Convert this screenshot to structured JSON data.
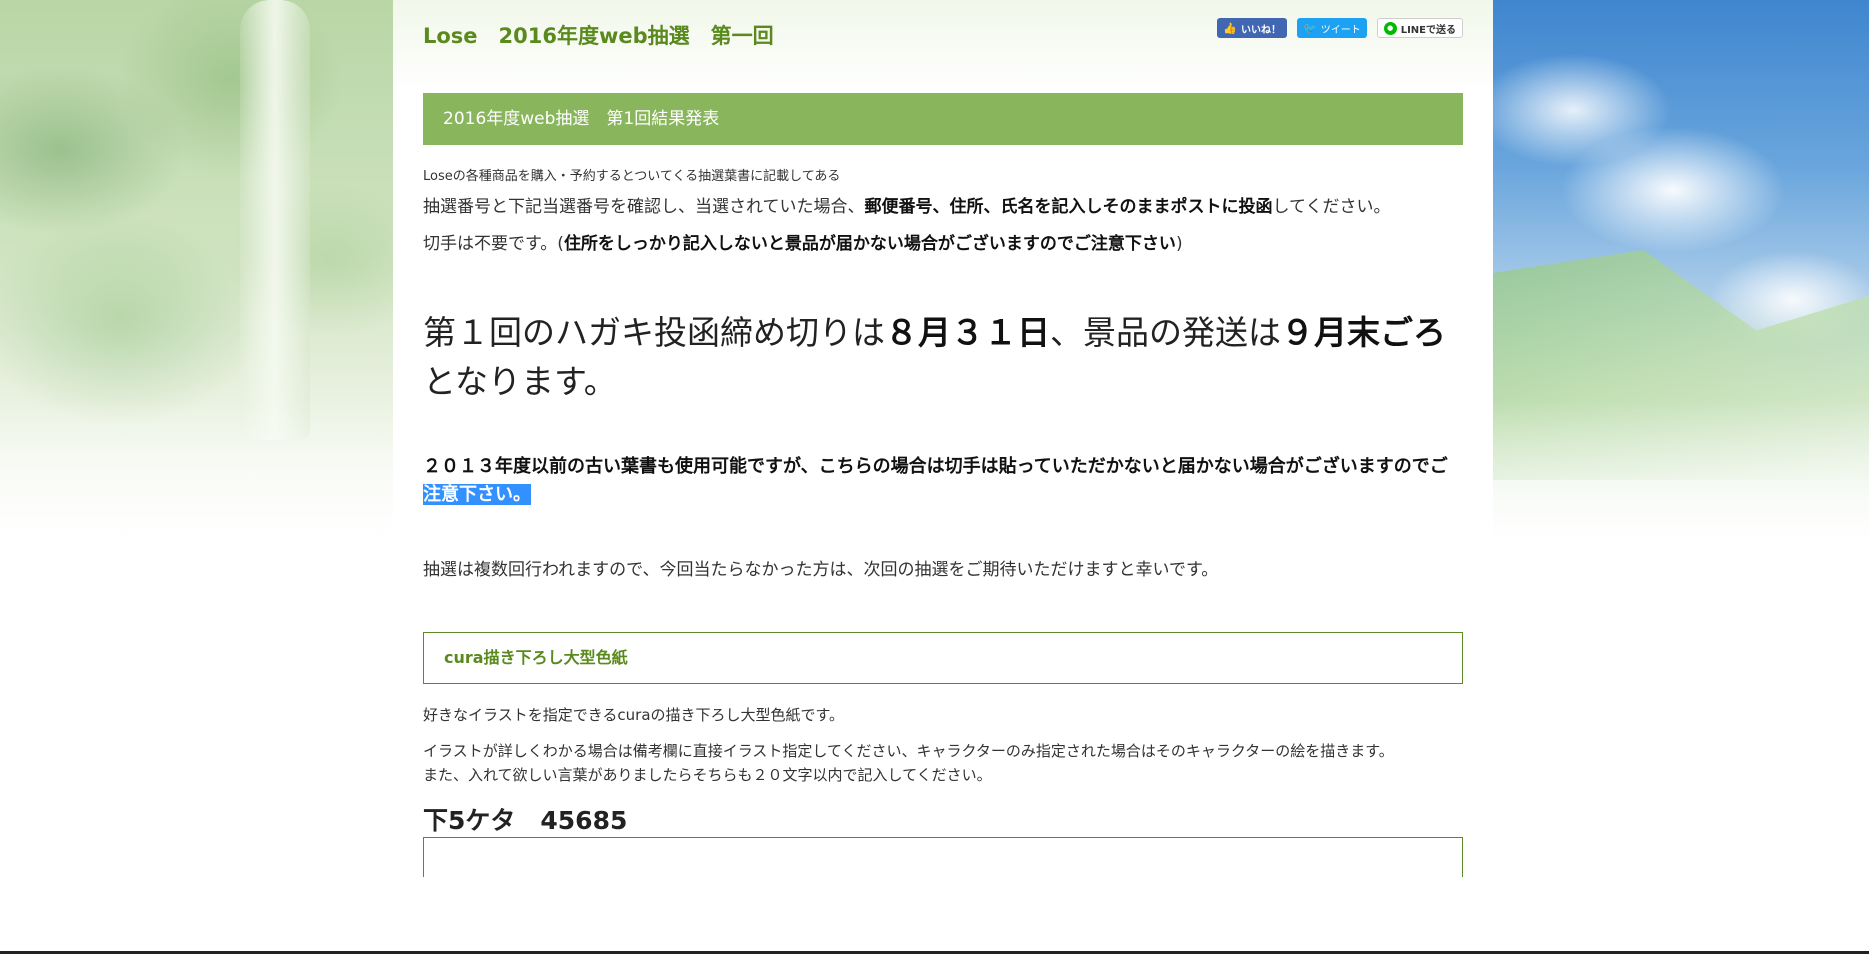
{
  "header": {
    "site_title": "Lose　2016年度web抽選　第一回",
    "social": {
      "facebook_label": "いいね！",
      "twitter_label": "ツイート",
      "line_label": "LINEで送る",
      "facebook_icon": "thumbs-up-icon",
      "twitter_icon": "twitter-bird-icon",
      "line_icon": "line-logo-icon"
    }
  },
  "banner": {
    "title": "2016年度web抽選　第1回結果発表"
  },
  "intro": {
    "small_note": "Loseの各種商品を購入・予約するとついてくる抽選葉書に記載してある",
    "p1_before": "抽選番号と下記当選番号を確認し、当選されていた場合、",
    "p1_bold": "郵便番号、住所、氏名を記入しそのままポストに投函",
    "p1_after": "してください。",
    "p2_before": "切手は不要です。(",
    "p2_bold": "住所をしっかり記入しないと景品が届かない場合がございますのでご注意下さい",
    "p2_after": ")"
  },
  "deadline": {
    "part1": "第１回のハガキ投函締め切りは",
    "date_bold": "８月３１日",
    "part2": "、景品の発送は",
    "ship_bold": "９月末ごろ",
    "part3": "となります。"
  },
  "old_card_notice": {
    "text": "２０１３年度以前の古い葉書も使用可能ですが、こちらの場合は切手は貼っていただかないと届かない場合がございますのでご",
    "highlighted": "注意下さい。"
  },
  "lottery_note": "抽選は複数回行われますので、今回当たらなかった方は、次回の抽選をご期待いただけますと幸いです。",
  "prize": {
    "name": "cura描き下ろし大型色紙",
    "desc1": "好きなイラストを指定できるcuraの描き下ろし大型色紙です。",
    "desc2_line1": "イラストが詳しくわかる場合は備考欄に直接イラスト指定してください、キャラクターのみ指定された場合はそのキャラクターの絵を描きます。",
    "desc2_line2": "また、入れて欲しい言葉がありましたらそちらも２０文字以内で記入してください。",
    "winning_number": "下5ケタ　45685"
  },
  "colors": {
    "accent_green": "#89b55d",
    "title_green": "#5a8a1e",
    "highlight_blue": "#3390ff"
  }
}
